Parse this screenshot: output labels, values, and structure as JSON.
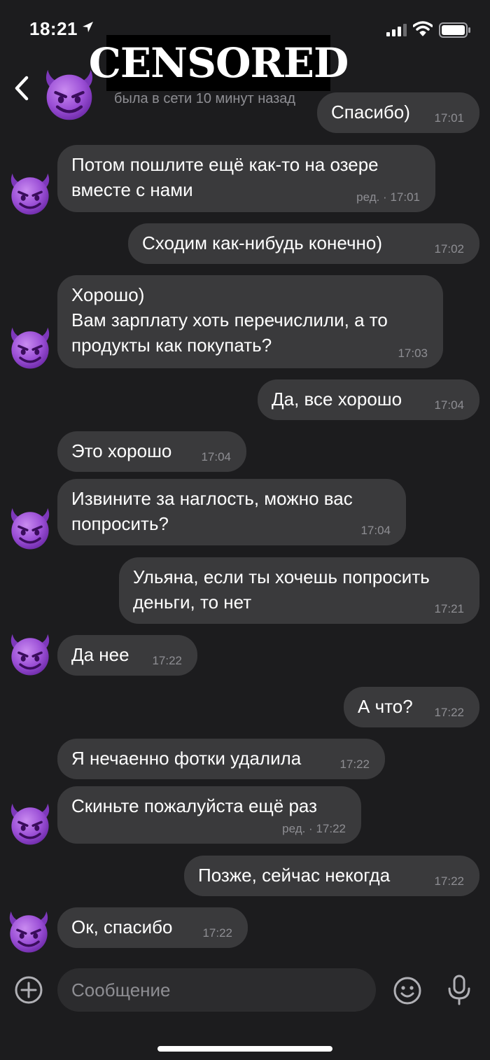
{
  "status_bar": {
    "time": "18:21"
  },
  "header": {
    "censored_label": "CENSORED",
    "last_seen": "была в сети 10 минут назад"
  },
  "messages": [
    {
      "side": "out",
      "text": "Спасибо)",
      "time": "17:01"
    },
    {
      "side": "in",
      "text": "Потом пошлите ещё как-то на озере\nвместе с нами",
      "edited": "ред. · ",
      "time": "17:01"
    },
    {
      "side": "out",
      "text": "Сходим как-нибудь конечно)",
      "time": "17:02"
    },
    {
      "side": "in",
      "text": "Хорошо)\nВам зарплату хоть перечислили, а то\nпродукты как покупать?",
      "time": "17:03"
    },
    {
      "side": "out",
      "text": "Да, все хорошо",
      "time": "17:04"
    },
    {
      "side": "in",
      "text": "Это хорошо",
      "time": "17:04"
    },
    {
      "side": "in",
      "text": "Извините за наглость, можно вас\nпопросить?",
      "time": "17:04"
    },
    {
      "side": "out",
      "text": "Ульяна, если ты хочешь попросить\nденьги, то нет",
      "time": "17:21"
    },
    {
      "side": "in",
      "text": "Да нее",
      "time": "17:22"
    },
    {
      "side": "out",
      "text": "А что?",
      "time": "17:22"
    },
    {
      "side": "in",
      "text": "Я нечаенно фотки удалила",
      "time": "17:22"
    },
    {
      "side": "in",
      "text": "Скиньте пожалуйста ещё раз",
      "edited": "ред. · ",
      "time": "17:22"
    },
    {
      "side": "out",
      "text": "Позже, сейчас некогда",
      "time": "17:22"
    },
    {
      "side": "in",
      "text": "Ок, спасибо",
      "time": "17:22"
    }
  ],
  "composer": {
    "placeholder": "Сообщение"
  },
  "icons": {
    "avatar": "devil-emoji-icon",
    "back": "chevron-left-icon",
    "add": "plus-circle-icon",
    "emoji": "smiley-icon",
    "mic": "microphone-icon"
  },
  "colors": {
    "background": "#1c1c1e",
    "bubble": "#3a3a3c",
    "avatar": "#9b4fd6",
    "secondary_text": "#8e8e93"
  }
}
